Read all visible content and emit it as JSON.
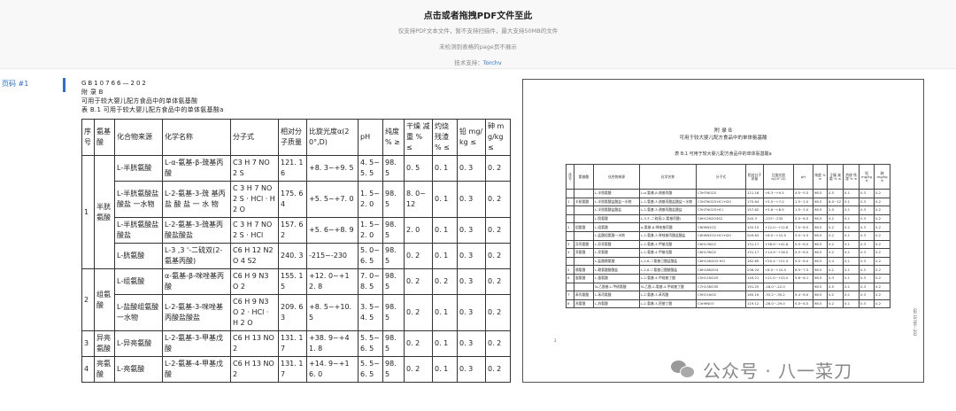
{
  "header": {
    "title": "点击或者拖拽PDF文件至此",
    "line1": "仅支持PDF文本文件，暂不支持扫描件，最大支持50MB的文件",
    "line2": "未检测到表格的page页不展示",
    "tech_prefix": "技术支持：",
    "tech_link": "Torchv"
  },
  "page_label": "页码 #1",
  "doc": {
    "code": "GB10766—202",
    "appendix": "附 录 B",
    "heading": "可用于较大婴儿配方食品中的单体氨基酸",
    "caption": "表 B.1 可用于较大婴儿配方食品中的单体氨基酸a"
  },
  "table": {
    "headers": [
      "序号",
      "氨基酸",
      "化合物来源",
      "化学名称",
      "分子式",
      "相对分子质量",
      "比旋光度α(20°,D)",
      "pH",
      "纯度 % ≥",
      "干燥 减重 % ≤",
      "灼烧 残渣 % ≤",
      "铅 mg/kg ≤",
      "砷 mg/kg ≤"
    ],
    "groups": [
      {
        "no": "1",
        "aa": "半胱氨酸",
        "rows": [
          [
            "L-半胱氨酸",
            "L-α-氨基-β-巯基丙酸",
            "C3 H 7 NO 2 S",
            "121. 16",
            "+8. 3~+9. 5",
            "4. 5~5. 5",
            "98. 5",
            "0. 5",
            "0. 1",
            "0. 3",
            "0. 2"
          ],
          [
            "L-半胱氨酸盐酸盐 一水物",
            "L-2-氨基-3-巯 基丙 盐 酸 盐 一 水 物",
            "C 3 H 7 NO 2 S · HCl · H 2 O",
            "175. 64",
            "+5. 5~+7. 0",
            "1. 5~2. 0",
            "98. 5",
            "8. 0~12",
            "0. 1",
            "0. 3",
            "0. 2"
          ],
          [
            "L-半胱氨酸盐酸盐",
            "L-2-氨基-3-巯基丙酸盐酸盐",
            "C 3 H 7 NO 2 S · HCl",
            "157. 62",
            "+5. 6~+8. 9",
            "1. 5~2. 0",
            "98. 5",
            "2. 0",
            "0. 1",
            "0. 3",
            "0. 2"
          ],
          [
            "L-胱氨酸",
            "L-3 ,3 '-二硫双(2-氨基丙酸)",
            "C6 H 12 N2 O 4 S2",
            "240. 3",
            "-215~-230",
            "5. 0~6. 5",
            "98. 5",
            "0. 2",
            "0. 1",
            "0. 3",
            "0. 2"
          ]
        ]
      },
      {
        "no": "2",
        "aa": "组氨酸",
        "rows": [
          [
            "L-组氨酸",
            "α-氨基-β-咪唑基丙酸",
            "C6 H 9 N3 O 2",
            "155. 15",
            "+12. 0~+12. 8",
            "7. 0~8. 5",
            "98. 5",
            "0. 2",
            "0. 2",
            "0. 3",
            "0. 2"
          ],
          [
            "L-盐酸组氨酸 一水物",
            "L-2-氨基-3-咪唑基丙酸盐酸盐",
            "C6 H 9 N3 O 2 · HCl · H 2 O",
            "209. 63",
            "+8. 5~+10. 5",
            "3. 5~4. 5",
            "98. 5",
            "0. 2",
            "0. 1",
            "0. 3",
            "0. 2"
          ]
        ]
      },
      {
        "no": "3",
        "aa": "异亮氨酸",
        "rows": [
          [
            "L-异亮氨酸",
            "L-2-氨基-3-甲基戊酸",
            "C6 H 13 NO 2",
            "131. 17",
            "+38. 9~+41. 8",
            "5. 5~6. 5",
            "98. 5",
            "0. 2",
            "0. 1",
            "0. 3",
            "0. 2"
          ]
        ]
      },
      {
        "no": "4",
        "aa": "亮氨酸",
        "rows": [
          [
            "L-亮氨酸",
            "L-2-氨基-4-甲基戊酸",
            "C6 H 13 NO 2",
            "131. 17",
            "+14. 9~+16. 0",
            "5. 5~6. 5",
            "98. 5",
            "0. 2",
            "0. 1",
            "0. 3",
            "0. 2"
          ]
        ]
      }
    ]
  },
  "preview": {
    "title1": "附 录 B",
    "title2": "可用于较大婴儿配方食品中的单体氨基酸",
    "title3": "表 B.1  可用于较大婴儿配方食品中的单体氨基酸a",
    "headers": [
      "序号",
      "氨基酸",
      "化合物来源",
      "化学名称",
      "分子式",
      "相对分子质量",
      "比旋光度 α(20°,D)",
      "pH",
      "纯度 % ≥",
      "干燥 减重 % ≤",
      "灼烧 残渣 % ≤",
      "铅 mg/kg ≤",
      "砷 mg/kg ≤"
    ],
    "rows": [
      [
        "",
        "",
        "L-半胱氨酸",
        "L-α-氨基-β-巯基丙酸",
        "C3H7NO2S",
        "121.16",
        "+8.3~+9.5",
        "4.5~5.5",
        "98.5",
        "0.5",
        "0.1",
        "0.3",
        "0.2"
      ],
      [
        "1",
        "半胱氨酸",
        "L-半胱氨酸盐酸盐一水物",
        "L-2-氨基-3-巯基丙酸盐酸盐一水物",
        "C3H7NO2S·HCl·H2O",
        "175.64",
        "+5.5~+7.0",
        "1.5~2.0",
        "98.5",
        "8.0~12",
        "0.1",
        "0.3",
        "0.2"
      ],
      [
        "",
        "",
        "L-半胱氨酸盐酸盐",
        "L-2-氨基-3-巯基丙酸盐酸盐",
        "C3H7NO2S·HCl",
        "157.62",
        "+5.6~+8.9",
        "1.5~2.0",
        "98.5",
        "2.0",
        "0.1",
        "0.3",
        "0.2"
      ],
      [
        "",
        "",
        "L-胱氨酸",
        "L-3,3'-二硫双(2-氨基丙酸)",
        "C6H12N2O4S2",
        "240.3",
        "-215~-230",
        "5.0~6.5",
        "98.5",
        "0.2",
        "0.1",
        "0.3",
        "0.2"
      ],
      [
        "2",
        "组氨酸",
        "L-组氨酸",
        "α-氨基-β-咪唑基丙酸",
        "C6H9N3O2",
        "155.15",
        "+12.0~+12.8",
        "7.0~8.5",
        "98.5",
        "0.2",
        "0.2",
        "0.3",
        "0.2"
      ],
      [
        "",
        "",
        "L-盐酸组氨酸一水物",
        "L-2-氨基-3-咪唑基丙酸盐酸盐",
        "C6H9N3O2·HCl·H2O",
        "209.63",
        "+8.5~+10.5",
        "3.5~4.5",
        "98.5",
        "0.2",
        "0.1",
        "0.3",
        "0.2"
      ],
      [
        "3",
        "异亮氨酸",
        "L-异亮氨酸",
        "L-2-氨基-3-甲基戊酸",
        "C6H13NO2",
        "131.17",
        "+38.9~+41.8",
        "5.5~6.5",
        "98.5",
        "0.2",
        "0.1",
        "0.3",
        "0.2"
      ],
      [
        "4",
        "亮氨酸",
        "L-亮氨酸",
        "L-2-氨基-4-甲基戊酸",
        "C6H13NO2",
        "131.17",
        "+14.9~+16.0",
        "5.5~6.5",
        "98.5",
        "0.2",
        "0.1",
        "0.3",
        "0.2"
      ],
      [
        "",
        "",
        "L-盐酸赖氨酸",
        "L-2,6-二氨基己酸盐酸盐",
        "C6H14N2O2·HCl",
        "182.65",
        "+20.4~+21.5",
        "5.0~6.0",
        "98.5",
        "0.4",
        "0.1",
        "0.3",
        "0.2"
      ],
      [
        "5",
        "赖氨酸",
        "L-赖氨酸醋酸盐",
        "L-2,6-二氨基己酸醋酸盐",
        "C8H18N2O4",
        "206.24",
        "+8.5~+10.0",
        "6.5~7.5",
        "98.5",
        "0.2",
        "0.1",
        "0.3",
        "0.2"
      ],
      [
        "6",
        "蛋氨酸",
        "L-蛋氨酸",
        "L-2-氨基-4-甲硫基丁酸",
        "C5H11NO2S",
        "149.21",
        "+21.0~+25.0",
        "5.6~6.1",
        "98.5",
        "0.3",
        "0.1",
        "0.3",
        "0.2"
      ],
      [
        "",
        "",
        "N-乙酰基-L-甲硫氨酸",
        "N-乙酰-2-氨基-4-甲硫基丁酸",
        "C7H13NO3S",
        "191.25",
        "-18.0~-22.0",
        "",
        "98.5",
        "0.5",
        "0.1",
        "0.3",
        "0.2"
      ],
      [
        "7",
        "苯丙氨酸",
        "L-苯丙氨酸",
        "L-2-氨基-3-苯丙酸",
        "C9H11NO2",
        "165.19",
        "-33.2~-35.2",
        "5.4~6.0",
        "98.5",
        "0.2",
        "0.1",
        "0.3",
        "0.2"
      ],
      [
        "8",
        "苏氨酸",
        "L-苏氨酸",
        "L-2-氨基-3-羟基丁酸",
        "C4H9NO3",
        "119.12",
        "-26.0~-29.0",
        "5.0~6.5",
        "98.5",
        "0.2",
        "0.1",
        "0.3",
        "0.2"
      ]
    ],
    "side_code": "GB 10766—202",
    "page_no": "2"
  },
  "watermark": "公众号 · 八一菜刀"
}
